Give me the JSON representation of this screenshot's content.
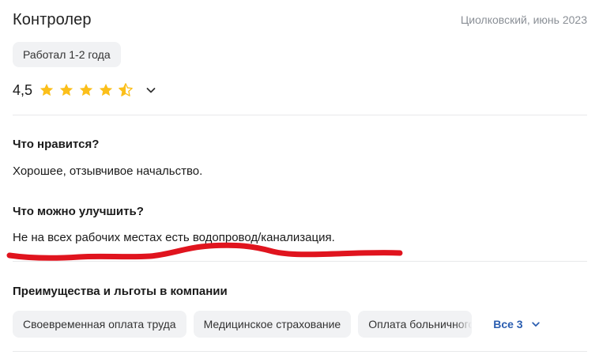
{
  "review": {
    "position": "Контролер",
    "meta": "Циолковский, июнь 2023",
    "tenure": "Работал 1-2 года",
    "rating": {
      "value_label": "4,5",
      "value": 4.5,
      "max": 5,
      "star_color": "#fbbf1a"
    },
    "pros": {
      "heading": "Что нравится?",
      "text": "Хорошее, отзывчивое начальство."
    },
    "cons": {
      "heading": "Что можно улучшить?",
      "text": "Не на всех рабочих местах есть водопровод/канализация."
    },
    "benefits": {
      "heading": "Преимущества и льготы в компании",
      "items": [
        "Своевременная оплата труда",
        "Медицинское страхование",
        "Оплата больничного"
      ],
      "show_all_label": "Все 3"
    }
  },
  "annotation": {
    "color": "#e0141e"
  },
  "icons": {
    "star": "star-icon",
    "half_star": "half-star-icon",
    "chevron": "chevron-down-icon"
  },
  "colors": {
    "link": "#2a5db0",
    "chip_bg": "#f1f2f4",
    "muted_text": "#8a8f96"
  }
}
